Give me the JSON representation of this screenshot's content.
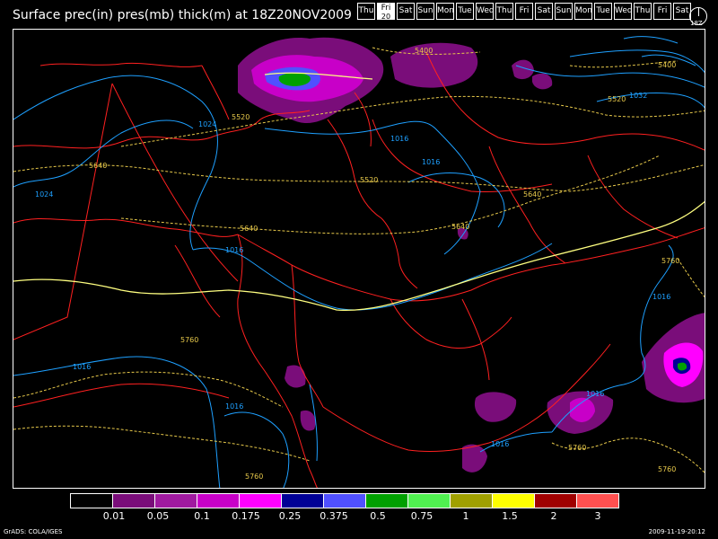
{
  "title": "Surface prec(in) pres(mb) thick(m) at 18Z20NOV2009",
  "days": [
    {
      "label": "Thu",
      "selected": false
    },
    {
      "label": "Fri",
      "num": "20",
      "selected": true
    },
    {
      "label": "Sat",
      "selected": false
    },
    {
      "label": "Sun",
      "selected": false
    },
    {
      "label": "Mon",
      "selected": false
    },
    {
      "label": "Tue",
      "selected": false
    },
    {
      "label": "Wed",
      "selected": false
    },
    {
      "label": "Thu",
      "selected": false
    },
    {
      "label": "Fri",
      "selected": false
    },
    {
      "label": "Sat",
      "selected": false
    },
    {
      "label": "Sun",
      "selected": false
    },
    {
      "label": "Mon",
      "selected": false
    },
    {
      "label": "Tue",
      "selected": false
    },
    {
      "label": "Wed",
      "selected": false
    },
    {
      "label": "Thu",
      "selected": false
    },
    {
      "label": "Fri",
      "selected": false
    },
    {
      "label": "Sat",
      "selected": false
    }
  ],
  "clock_label": "18Z",
  "contour_labels": {
    "pressure": [
      "1024",
      "1024",
      "1016",
      "1016",
      "1016",
      "1016",
      "1016",
      "1016",
      "1016",
      "1016",
      "1032"
    ],
    "thickness": [
      "5400",
      "5400",
      "5520",
      "5520",
      "5520",
      "5640",
      "5640",
      "5640",
      "5640",
      "5760",
      "5760",
      "5760",
      "5760",
      "5760"
    ]
  },
  "colorbar": {
    "colors": [
      "#000000",
      "#7a0d7a",
      "#a01aa0",
      "#c800c8",
      "#ff00ff",
      "#000096",
      "#5050ff",
      "#00a000",
      "#50f050",
      "#a0a000",
      "#ffff00",
      "#a00000",
      "#ff5050"
    ],
    "labels": [
      "0.01",
      "0.05",
      "0.1",
      "0.175",
      "0.25",
      "0.375",
      "0.5",
      "0.75",
      "1",
      "1.5",
      "2",
      "3"
    ]
  },
  "footer": {
    "left": "GrADS: COLA/IGES",
    "right": "2009-11-19-20:12"
  },
  "map_colors": {
    "coast": "#ff2020",
    "pressure": "#1ea0ff",
    "thickness": "#e6c84a",
    "thickness_5640": "#ffff80"
  }
}
